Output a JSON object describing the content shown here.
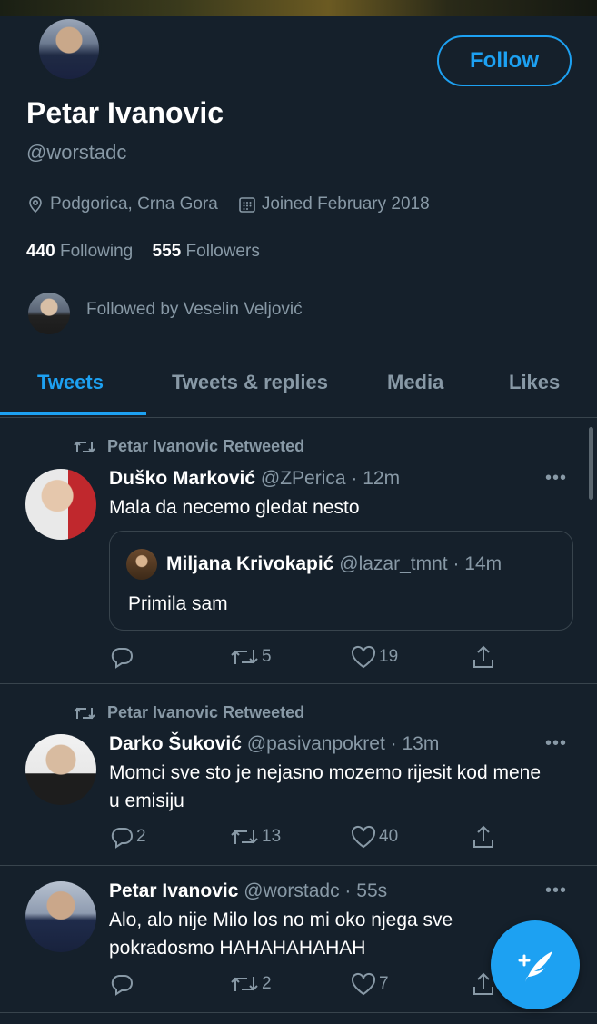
{
  "profile": {
    "name": "Petar Ivanovic",
    "handle": "@worstadc",
    "location": "Podgorica, Crna Gora",
    "joined": "Joined February 2018",
    "following_count": "440",
    "following_label": "Following",
    "followers_count": "555",
    "followers_label": "Followers",
    "followed_by": "Followed by Veselin Veljović",
    "follow_button": "Follow"
  },
  "tabs": [
    {
      "label": "Tweets",
      "active": true
    },
    {
      "label": "Tweets & replies",
      "active": false
    },
    {
      "label": "Media",
      "active": false
    },
    {
      "label": "Likes",
      "active": false
    }
  ],
  "tweets": [
    {
      "retweeted_by": "Petar Ivanovic Retweeted",
      "author": "Duško Marković",
      "handle": "@ZPerica · 12m",
      "text": "Mala da necemo gledat nesto",
      "quote": {
        "author": "Miljana Krivokapić",
        "handle": "@lazar_tmnt · 14m",
        "text": "Primila sam"
      },
      "replies": "",
      "retweets": "5",
      "likes": "19"
    },
    {
      "retweeted_by": "Petar Ivanovic Retweeted",
      "author": "Darko Šuković",
      "handle": "@pasivanpokret · 13m",
      "text": "Momci sve sto je nejasno mozemo rijesit kod mene u emisiju",
      "replies": "2",
      "retweets": "13",
      "likes": "40"
    },
    {
      "author": "Petar Ivanovic",
      "handle": "@worstadc · 55s",
      "text": "Alo, alo nije Milo los no mi oko njega sve pokradosmo HAHAHAHAHAH",
      "replies": "",
      "retweets": "2",
      "likes": "7"
    }
  ],
  "colors": {
    "background": "#15202b",
    "accent": "#1da1f2",
    "muted": "#8899a6",
    "divider": "#38444d"
  },
  "icons": {
    "more": "•••",
    "fab": "compose-tweet-icon"
  }
}
